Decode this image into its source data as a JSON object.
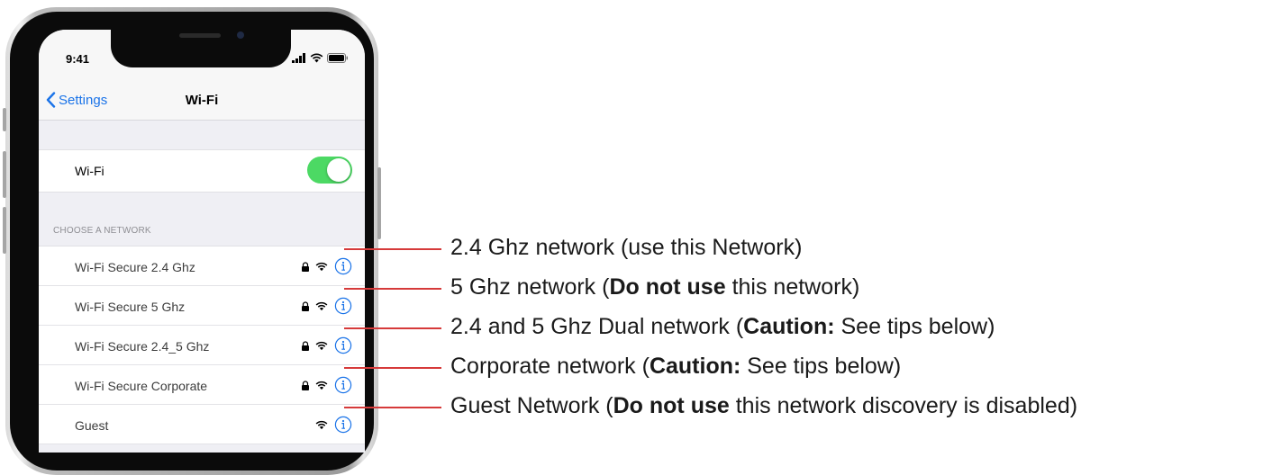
{
  "status_bar": {
    "time": "9:41"
  },
  "nav": {
    "back_label": "Settings",
    "title": "Wi-Fi"
  },
  "wifi_toggle": {
    "label": "Wi-Fi",
    "on": true,
    "on_color": "#4cd964"
  },
  "section_header": "CHOOSE A NETWORK",
  "networks": [
    {
      "name": "Wi-Fi Secure 2.4 Ghz",
      "secured": true,
      "icons": [
        "lock-icon",
        "wifi-icon",
        "info-icon"
      ]
    },
    {
      "name": "Wi-Fi Secure 5 Ghz",
      "secured": true,
      "icons": [
        "lock-icon",
        "wifi-icon",
        "info-icon"
      ]
    },
    {
      "name": "Wi-Fi Secure 2.4_5 Ghz",
      "secured": true,
      "icons": [
        "lock-icon",
        "wifi-icon",
        "info-icon"
      ]
    },
    {
      "name": "Wi-Fi Secure Corporate",
      "secured": true,
      "icons": [
        "lock-icon",
        "wifi-icon",
        "info-icon"
      ]
    },
    {
      "name": "Guest",
      "secured": false,
      "icons": [
        "wifi-icon",
        "info-icon"
      ]
    }
  ],
  "callouts": [
    {
      "prefix": "2.4 Ghz network (use this Network)",
      "bold": "",
      "suffix": ""
    },
    {
      "prefix": "5 Ghz network (",
      "bold": "Do not use",
      "suffix": " this network)"
    },
    {
      "prefix": "2.4 and 5 Ghz Dual network (",
      "bold": "Caution:",
      "suffix": " See tips below)"
    },
    {
      "prefix": "Corporate network (",
      "bold": "Caution:",
      "suffix": " See tips below)"
    },
    {
      "prefix": "Guest Network (",
      "bold": "Do not use",
      "suffix": " this network discovery is disabled)"
    }
  ],
  "colors": {
    "accent": "#1a73e8",
    "callout_line": "#d63a3a",
    "toggle_on": "#4cd964"
  }
}
